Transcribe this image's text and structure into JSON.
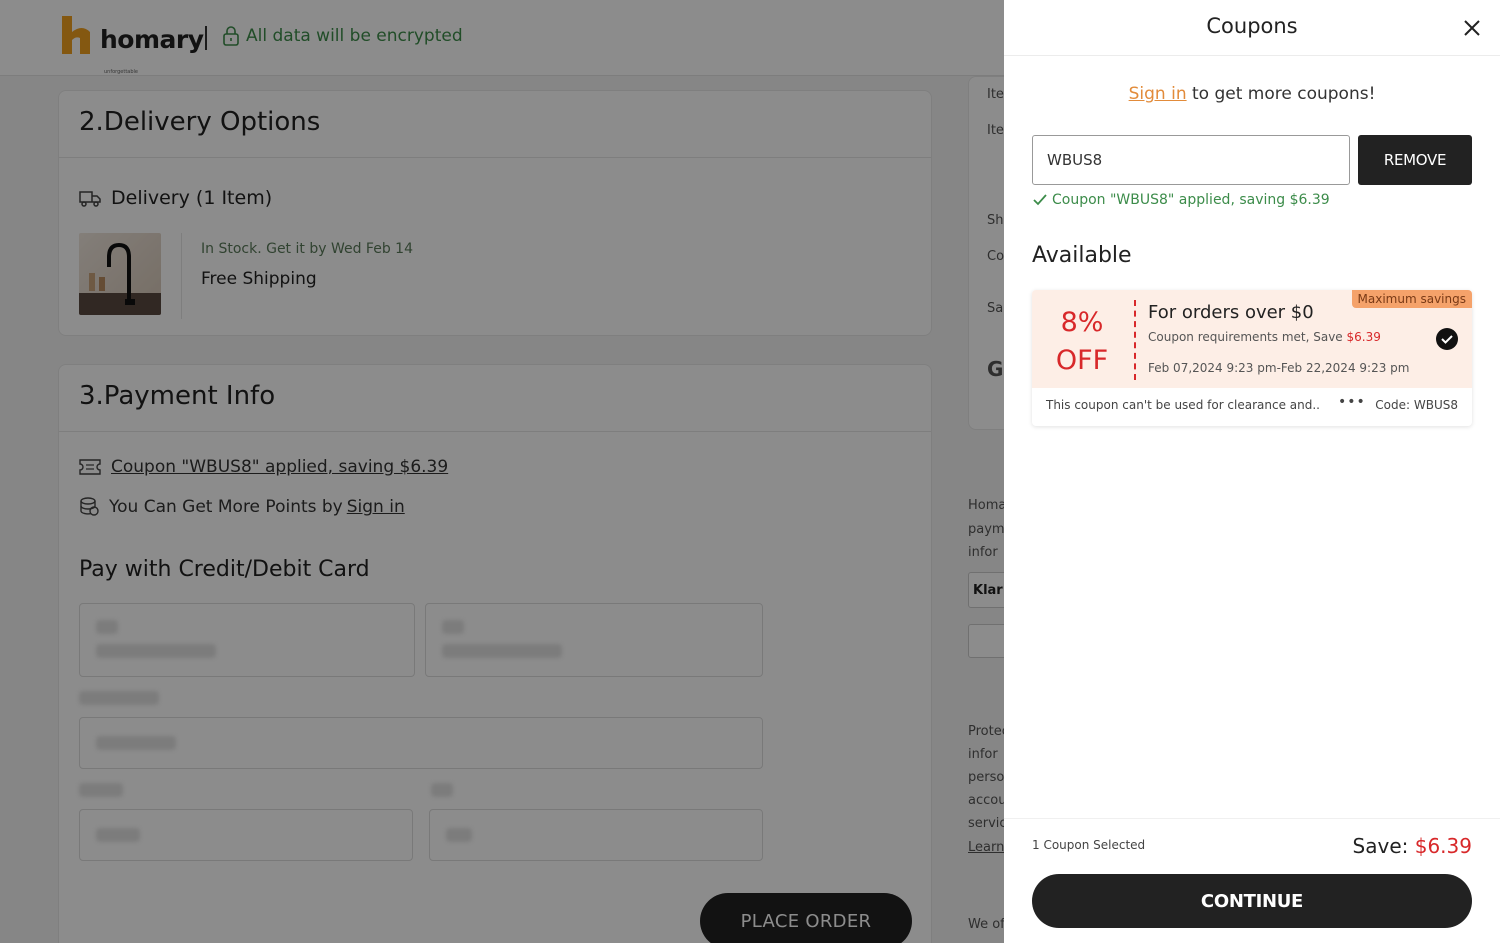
{
  "header": {
    "brand": "homary",
    "brand_tagline": "unforgettable",
    "security_text": "All data will be encrypted"
  },
  "delivery": {
    "section_title": "2.Delivery Options",
    "delivery_label": "Delivery (1 Item)",
    "stock_text": "In Stock. Get it by Wed Feb 14",
    "shipping_text": "Free Shipping"
  },
  "payment": {
    "section_title": "3.Payment Info",
    "coupon_applied_link": "Coupon \"WBUS8\" applied, saving $6.39",
    "points_text": "You Can Get More Points by",
    "points_signin": "Sign in",
    "card_heading": "Pay with Credit/Debit Card"
  },
  "place_order": "PLACE ORDER",
  "coupons_drawer": {
    "title": "Coupons",
    "signin_link": "Sign in",
    "signin_suffix": "to get more coupons!",
    "input_value": "WBUS8",
    "remove_label": "REMOVE",
    "applied_message": "Coupon \"WBUS8\" applied, saving $6.39",
    "available_heading": "Available",
    "coupon": {
      "percent": "8%",
      "off": "OFF",
      "badge": "Maximum savings",
      "condition": "For orders over $0",
      "requirement": "Coupon requirements met, Save",
      "requirement_amount": "$6.39",
      "date_range": "Feb 07,2024 9:23 pm-Feb 22,2024 9:23 pm",
      "restriction": "This coupon can't be used for clearance and..",
      "more": "•••",
      "code": "Code: WBUS8"
    },
    "selected_count": "1 Coupon Selected",
    "save_label": "Save:",
    "save_amount": "$6.39",
    "continue_label": "CONTINUE"
  },
  "colors": {
    "accent_red": "#d8282a",
    "success_green": "#3c8c4a",
    "link_orange": "#e28b3a",
    "coupon_bg": "#fdeee6",
    "button_dark": "#222222"
  }
}
